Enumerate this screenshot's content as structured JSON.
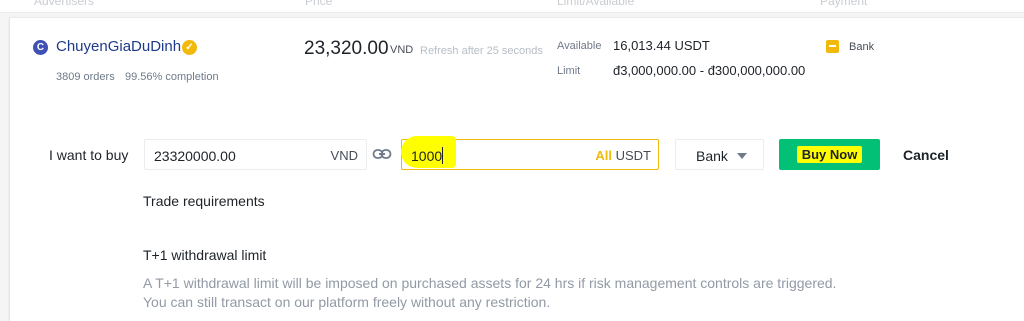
{
  "header": {
    "col_advertisers": "Advertisers",
    "col_price": "Price",
    "col_limit_available": "Limit/Available",
    "col_payment": "Payment"
  },
  "advertiser": {
    "avatar_letter": "C",
    "name": "ChuyenGiaDuDinh",
    "verified_icon": "check-badge-icon",
    "orders": "3809 orders",
    "completion": "99.56% completion"
  },
  "price": {
    "value": "23,320.00",
    "currency": "VND",
    "refresh_note": "Refresh after 25 seconds"
  },
  "availability": {
    "available_label": "Available",
    "available_value": "16,013.44 USDT",
    "limit_label": "Limit",
    "limit_value": "đ3,000,000.00 - đ300,000,000.00"
  },
  "payment": {
    "method": "Bank",
    "icon": "bank-card-icon",
    "icon_color": "#f0b90b"
  },
  "order_form": {
    "want_label": "I want to buy",
    "fiat_amount": "23320000.00",
    "fiat_currency": "VND",
    "link_icon": "link-icon",
    "crypto_amount": "1000",
    "all_label": "All",
    "crypto_currency": "USDT",
    "payment_select": "Bank",
    "buy_button": "Buy Now",
    "cancel_button": "Cancel"
  },
  "requirements": {
    "title": "Trade requirements",
    "t1_title": "T+1 withdrawal limit",
    "t1_line1": "A T+1 withdrawal limit will be imposed on purchased assets for 24 hrs if risk management controls are triggered.",
    "t1_line2": "You can still transact on our platform freely without any restriction."
  },
  "colors": {
    "accent": "#f0b90b",
    "buy": "#02c076",
    "highlight": "#ffff00"
  }
}
